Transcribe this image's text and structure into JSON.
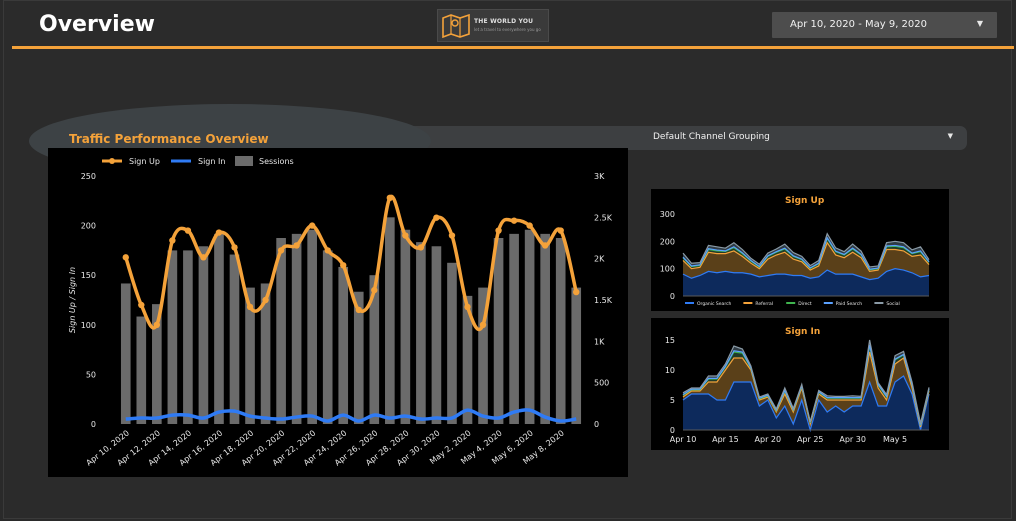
{
  "header": {
    "title": "Overview",
    "logo_line1": "THE WORLD YOU",
    "logo_line2": "let a travel to everywhere you go",
    "date_range": "Apr 10, 2020 - May 9, 2020"
  },
  "filter": {
    "label": "Default Channel Grouping"
  },
  "colors": {
    "accent": "#f4a23a",
    "signin_blue": "#2f7bf5",
    "sessions_gray": "#6b6b6b"
  },
  "chart_data": [
    {
      "type": "line",
      "title": "Traffic Performance Overview",
      "ylabel": "Sign Up / Sign In",
      "ylim": [
        0,
        250
      ],
      "y2lim": [
        0,
        3000
      ],
      "yticks": [
        "0",
        "50",
        "100",
        "150",
        "200",
        "250"
      ],
      "y2ticks": [
        "0",
        "500",
        "1K",
        "1.5K",
        "2K",
        "2.5K",
        "3K"
      ],
      "legend": [
        "Sign Up",
        "Sign In",
        "Sessions"
      ],
      "x_tick_labels": [
        "Apr 10, 2020",
        "Apr 12, 2020",
        "Apr 14, 2020",
        "Apr 16, 2020",
        "Apr 18, 2020",
        "Apr 20, 2020",
        "Apr 22, 2020",
        "Apr 24, 2020",
        "Apr 26, 2020",
        "Apr 28, 2020",
        "Apr 30, 2020",
        "May 2, 2020",
        "May 4, 2020",
        "May 6, 2020",
        "May 8, 2020"
      ],
      "categories": [
        "Apr 10",
        "Apr 11",
        "Apr 12",
        "Apr 13",
        "Apr 14",
        "Apr 15",
        "Apr 16",
        "Apr 17",
        "Apr 18",
        "Apr 19",
        "Apr 20",
        "Apr 21",
        "Apr 22",
        "Apr 23",
        "Apr 24",
        "Apr 25",
        "Apr 26",
        "Apr 27",
        "Apr 28",
        "Apr 29",
        "Apr 30",
        "May 1",
        "May 2",
        "May 3",
        "May 4",
        "May 5",
        "May 6",
        "May 7",
        "May 8",
        "May 9"
      ],
      "series": [
        {
          "name": "Sessions",
          "axis": "right",
          "values": [
            1700,
            1300,
            1450,
            2100,
            2100,
            2150,
            2300,
            2050,
            1650,
            1700,
            2250,
            2300,
            2350,
            2100,
            1900,
            1600,
            1800,
            2500,
            2350,
            2200,
            2150,
            1950,
            1550,
            1650,
            2250,
            2300,
            2350,
            2300,
            2250,
            1650
          ]
        },
        {
          "name": "Sign Up",
          "axis": "left",
          "values": [
            168,
            120,
            100,
            185,
            195,
            168,
            193,
            178,
            118,
            125,
            175,
            180,
            200,
            175,
            160,
            115,
            135,
            228,
            190,
            178,
            208,
            190,
            118,
            100,
            195,
            205,
            200,
            180,
            195,
            133
          ]
        },
        {
          "name": "Sign In",
          "axis": "left",
          "values": [
            5,
            6,
            6,
            9,
            9,
            6,
            12,
            13,
            8,
            6,
            5,
            7,
            8,
            3,
            9,
            3,
            9,
            6,
            8,
            5,
            6,
            6,
            14,
            8,
            6,
            12,
            14,
            7,
            3,
            5
          ]
        }
      ]
    },
    {
      "type": "area",
      "title": "Sign Up",
      "ylim": [
        0,
        300
      ],
      "yticks": [
        "0",
        "100",
        "200",
        "300"
      ],
      "legend": [
        "Organic Search",
        "Referral",
        "Direct",
        "Paid Search",
        "Social"
      ],
      "categories": [
        "Apr 10",
        "Apr 11",
        "Apr 12",
        "Apr 13",
        "Apr 14",
        "Apr 15",
        "Apr 16",
        "Apr 17",
        "Apr 18",
        "Apr 19",
        "Apr 20",
        "Apr 21",
        "Apr 22",
        "Apr 23",
        "Apr 24",
        "Apr 25",
        "Apr 26",
        "Apr 27",
        "Apr 28",
        "Apr 29",
        "Apr 30",
        "May 1",
        "May 2",
        "May 3",
        "May 4",
        "May 5",
        "May 6",
        "May 7",
        "May 8",
        "May 9"
      ],
      "series": [
        {
          "name": "Organic Search",
          "values": [
            80,
            65,
            75,
            90,
            85,
            90,
            85,
            85,
            80,
            70,
            75,
            80,
            80,
            75,
            75,
            65,
            70,
            95,
            80,
            80,
            80,
            70,
            60,
            65,
            90,
            100,
            95,
            85,
            70,
            75
          ]
        },
        {
          "name": "Referral",
          "values": [
            50,
            35,
            30,
            70,
            70,
            65,
            80,
            60,
            40,
            30,
            60,
            70,
            80,
            60,
            50,
            30,
            40,
            100,
            70,
            60,
            80,
            70,
            30,
            30,
            80,
            70,
            70,
            60,
            80,
            40
          ]
        },
        {
          "name": "Direct",
          "values": [
            10,
            8,
            7,
            10,
            10,
            8,
            12,
            10,
            8,
            6,
            10,
            10,
            12,
            10,
            8,
            6,
            8,
            15,
            12,
            10,
            12,
            10,
            6,
            5,
            10,
            12,
            12,
            10,
            12,
            8
          ]
        },
        {
          "name": "Paid Search",
          "values": [
            2,
            2,
            2,
            3,
            3,
            2,
            3,
            3,
            2,
            2,
            2,
            2,
            3,
            2,
            2,
            2,
            2,
            3,
            2,
            2,
            3,
            2,
            2,
            2,
            3,
            3,
            3,
            2,
            3,
            2
          ]
        },
        {
          "name": "Social",
          "values": [
            15,
            10,
            8,
            12,
            12,
            10,
            15,
            12,
            8,
            8,
            10,
            10,
            15,
            12,
            10,
            8,
            10,
            15,
            12,
            10,
            15,
            12,
            8,
            8,
            12,
            15,
            15,
            12,
            15,
            8
          ]
        }
      ]
    },
    {
      "type": "area",
      "title": "Sign In",
      "ylim": [
        0,
        15
      ],
      "yticks": [
        "0",
        "5",
        "10",
        "15"
      ],
      "x_tick_labels": [
        "Apr 10",
        "Apr 15",
        "Apr 20",
        "Apr 25",
        "Apr 30",
        "May 5"
      ],
      "categories": [
        "Apr 10",
        "Apr 11",
        "Apr 12",
        "Apr 13",
        "Apr 14",
        "Apr 15",
        "Apr 16",
        "Apr 17",
        "Apr 18",
        "Apr 19",
        "Apr 20",
        "Apr 21",
        "Apr 22",
        "Apr 23",
        "Apr 24",
        "Apr 25",
        "Apr 26",
        "Apr 27",
        "Apr 28",
        "Apr 29",
        "Apr 30",
        "May 1",
        "May 2",
        "May 3",
        "May 4",
        "May 5",
        "May 6",
        "May 7",
        "May 8",
        "May 9"
      ],
      "series": [
        {
          "name": "Organic Search",
          "values": [
            5,
            6,
            6,
            6,
            5,
            5,
            8,
            8,
            8,
            4,
            5,
            2,
            4,
            1,
            5,
            0,
            5,
            3,
            4,
            3,
            4,
            4,
            8,
            4,
            4,
            8,
            9,
            6,
            0,
            6
          ]
        },
        {
          "name": "Referral",
          "values": [
            0.5,
            0.5,
            0.5,
            2,
            3,
            5,
            4,
            4,
            2,
            1,
            0.5,
            1,
            2,
            2,
            2,
            1,
            1,
            2,
            1,
            2,
            1,
            1,
            5,
            3,
            1,
            3,
            3,
            1,
            0.5,
            0.5
          ]
        },
        {
          "name": "Direct",
          "values": [
            0.3,
            0.2,
            0.2,
            0.5,
            0.5,
            0.5,
            1,
            0.8,
            0.3,
            0.2,
            0.2,
            0.2,
            0.5,
            0.3,
            0.3,
            0.2,
            0.3,
            0.3,
            0.3,
            0.3,
            0.3,
            0.3,
            1,
            0.5,
            0.5,
            0.7,
            0.5,
            0.5,
            0.3,
            0.3
          ]
        },
        {
          "name": "Paid Search",
          "values": [
            0.1,
            0.1,
            0.1,
            0.1,
            0.1,
            0.1,
            0.2,
            0.2,
            0.1,
            0.1,
            0.1,
            0.1,
            0.1,
            0.1,
            0.1,
            0.1,
            0.1,
            0.1,
            0.1,
            0.1,
            0.1,
            0.1,
            0.2,
            0.1,
            0.1,
            0.1,
            0.1,
            0.1,
            0.1,
            0.1
          ]
        },
        {
          "name": "Social",
          "values": [
            0.3,
            0.2,
            0.2,
            0.4,
            0.4,
            0.4,
            0.8,
            0.5,
            0.3,
            0.2,
            0.2,
            0.2,
            0.4,
            0.2,
            0.2,
            0.1,
            0.2,
            0.3,
            0.2,
            0.2,
            0.3,
            0.2,
            0.8,
            0.3,
            0.3,
            0.6,
            0.5,
            0.4,
            0.2,
            0.2
          ]
        }
      ]
    }
  ]
}
